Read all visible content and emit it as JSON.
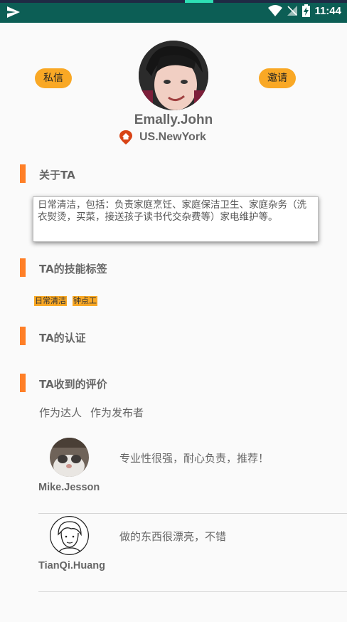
{
  "status_bar": {
    "time": "11:44"
  },
  "profile": {
    "name": "Emally.John",
    "location": "US.NewYork",
    "message_label": "私信",
    "invite_label": "邀请"
  },
  "sections": {
    "about": {
      "title": "关于TA",
      "text": "日常清洁，包括：负责家庭烹饪、家庭保洁卫生、家庭杂务（洗衣熨烫，买菜，接送孩子读书代交杂费等）家电维护等。"
    },
    "skills": {
      "title": "TA的技能标签",
      "tags": [
        "日常清洁",
        "钟点工"
      ]
    },
    "certification": {
      "title": "TA的认证"
    },
    "reviews": {
      "title": "TA收到的评价",
      "tabs": [
        "作为达人",
        "作为发布者"
      ],
      "items": [
        {
          "name": "Mike.Jesson",
          "text": "专业性很强，耐心负责，推荐！"
        },
        {
          "name": "TianQi.Huang",
          "text": "做的东西很漂亮，不错"
        }
      ]
    }
  },
  "colors": {
    "status_bar": "#0c5e55",
    "accent_pill": "#f9a825",
    "section_marker": "#ff7f27",
    "location_icon": "#d84315"
  }
}
